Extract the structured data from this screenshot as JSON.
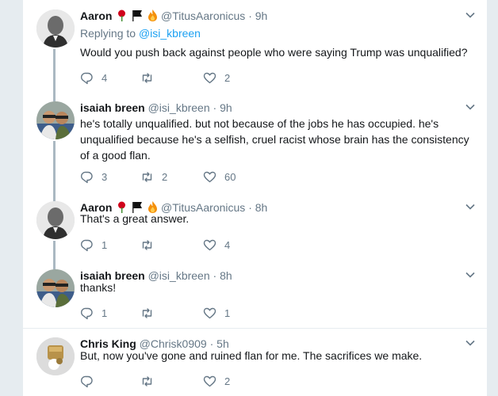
{
  "tweets": [
    {
      "name": "Aaron",
      "handle": "@TitusAaronicus",
      "time": "9h",
      "replying_prefix": "Replying to",
      "replying_to": "@isi_kbreen",
      "text": "Would you push back against people who were saying Trump was unqualified?",
      "replies": "4",
      "retweets": "",
      "likes": "2",
      "emojis": [
        "rose-emoji",
        "black-flag-emoji",
        "fire-emoji"
      ]
    },
    {
      "name": "isaiah breen",
      "handle": "@isi_kbreen",
      "time": "9h",
      "text": "he's totally unqualified. but not because of the jobs he has occupied. he's unqualified because he's a selfish, cruel racist whose brain has the consistency of a good flan.",
      "replies": "3",
      "retweets": "2",
      "likes": "60"
    },
    {
      "name": "Aaron",
      "handle": "@TitusAaronicus",
      "time": "8h",
      "text": "That's a great answer.",
      "replies": "1",
      "retweets": "",
      "likes": "4",
      "emojis": [
        "rose-emoji",
        "black-flag-emoji",
        "fire-emoji"
      ]
    },
    {
      "name": "isaiah breen",
      "handle": "@isi_kbreen",
      "time": "8h",
      "text": "thanks!",
      "replies": "1",
      "retweets": "",
      "likes": "1"
    },
    {
      "name": "Chris King",
      "handle": "@Chrisk0909",
      "time": "5h",
      "text": "But, now you've gone  and ruined flan for me.  The sacrifices we make.",
      "replies": "",
      "retweets": "",
      "likes": "2"
    }
  ],
  "separator": "·",
  "colors": {
    "link": "#1da1f2",
    "muted": "#657786",
    "thread": "#aab8c2"
  }
}
